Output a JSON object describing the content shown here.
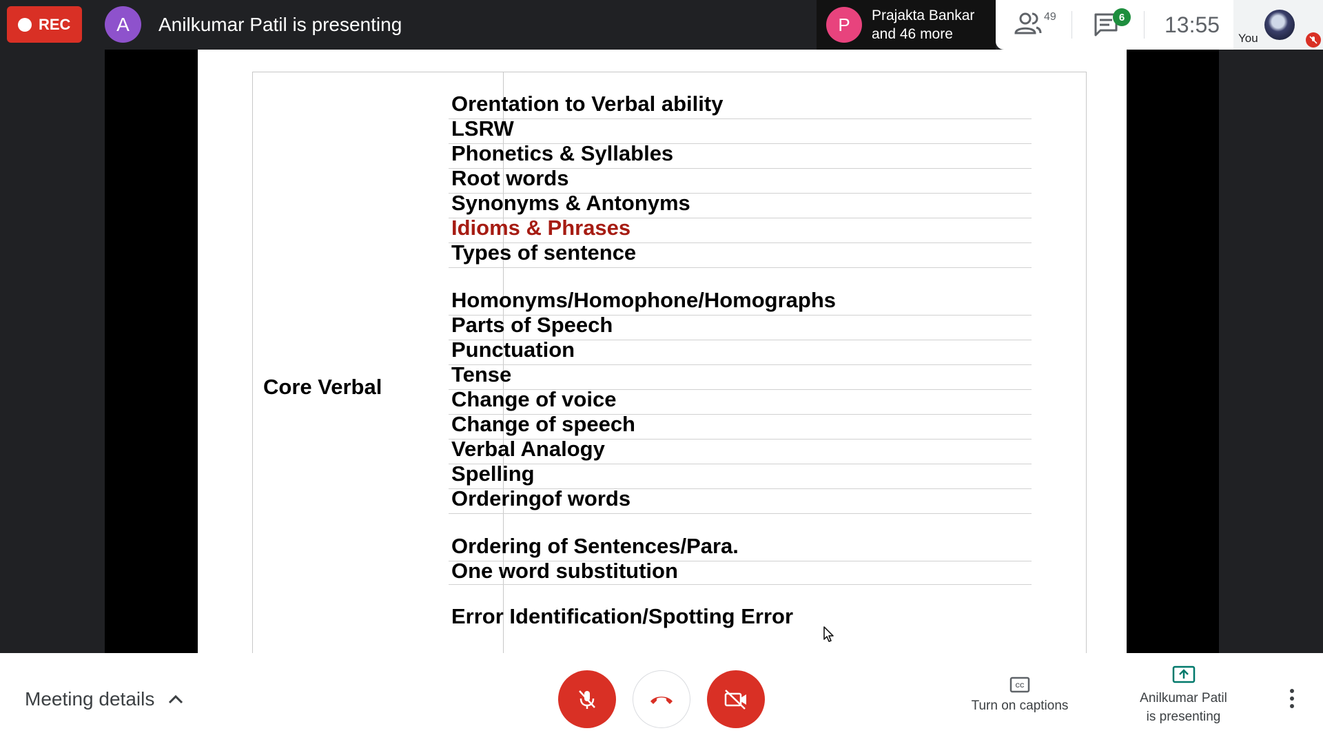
{
  "topbar": {
    "rec_label": "REC",
    "presenter_initial": "A",
    "presenting_text": "Anilkumar Patil is presenting",
    "participants_avatar_initial": "P",
    "participants_line1": "Prajakta Bankar",
    "participants_line2": "and 46 more",
    "people_count": "49",
    "chat_badge": "6",
    "clock": "13:55",
    "self_label": "You"
  },
  "slide": {
    "left_label": "Core Verbal",
    "topics": [
      {
        "text": "Orentation to Verbal ability",
        "highlight": false
      },
      {
        "text": "LSRW",
        "highlight": false
      },
      {
        "text": "Phonetics & Syllables",
        "highlight": false
      },
      {
        "text": "Root words",
        "highlight": false
      },
      {
        "text": "Synonyms & Antonyms",
        "highlight": false
      },
      {
        "text": "Idioms & Phrases",
        "highlight": true
      },
      {
        "text": "Types of sentence",
        "highlight": false
      },
      {
        "text": "Homonyms/Homophone/Homographs",
        "highlight": false
      },
      {
        "text": "Parts of Speech",
        "highlight": false
      },
      {
        "text": "Punctuation",
        "highlight": false
      },
      {
        "text": "Tense",
        "highlight": false
      },
      {
        "text": "Change of voice",
        "highlight": false
      },
      {
        "text": "Change of speech",
        "highlight": false
      },
      {
        "text": "Verbal Analogy",
        "highlight": false
      },
      {
        "text": "Spelling",
        "highlight": false
      },
      {
        "text": "Orderingof words",
        "highlight": false
      },
      {
        "text": "Ordering of Sentences/Para.",
        "highlight": false
      },
      {
        "text": "One word substitution",
        "highlight": false
      },
      {
        "text": "Error Identification/Spotting Error",
        "highlight": false
      }
    ]
  },
  "bottombar": {
    "meeting_details": "Meeting details",
    "captions_label": "Turn on captions",
    "presenting_label_1": "Anilkumar Patil",
    "presenting_label_2": "is presenting"
  },
  "colors": {
    "rec": "#d93025",
    "presenter_avatar": "#8e52cc",
    "participant_avatar": "#e8437d",
    "chat_badge": "#1e8e3e",
    "highlight_text": "#a61c13",
    "present_icon": "#00796b"
  },
  "icons": [
    "record-dot-icon",
    "people-icon",
    "chat-icon",
    "mic-off-icon",
    "hangup-icon",
    "camera-off-icon",
    "captions-icon",
    "present-icon",
    "more-vert-icon",
    "chevron-up-icon"
  ]
}
